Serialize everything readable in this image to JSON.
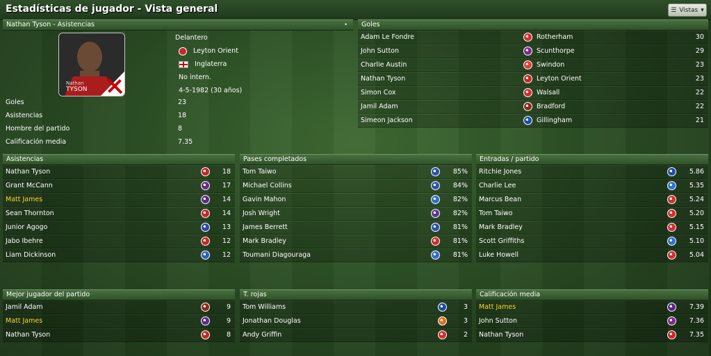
{
  "title": "Estadísticas de jugador - Vista general",
  "views_label": "Vistas",
  "player": {
    "panel_title": "Nathan Tyson - Asistencias",
    "photo_first": "Nathan",
    "photo_last": "TYSON",
    "position": "Delantero",
    "club": "Leyton Orient",
    "nation": "Inglaterra",
    "intl": "No intern.",
    "dob": "4-5-1982 (30 años)",
    "stats": [
      {
        "label": "Goles",
        "value": "23"
      },
      {
        "label": "Asistencias",
        "value": "18"
      },
      {
        "label": "Hombre del partido",
        "value": "8"
      },
      {
        "label": "Calificación media",
        "value": "7.35"
      }
    ]
  },
  "goals": {
    "title": "Goles",
    "rows": [
      {
        "name": "Adam Le Fondre",
        "team": "Rotherham",
        "value": "30",
        "color": "#d32f2f"
      },
      {
        "name": "John Sutton",
        "team": "Scunthorpe",
        "value": "29",
        "color": "#7a2a8a"
      },
      {
        "name": "Charlie Austin",
        "team": "Swindon",
        "value": "23",
        "color": "#e53935"
      },
      {
        "name": "Nathan Tyson",
        "team": "Leyton Orient",
        "value": "23",
        "color": "#c62828"
      },
      {
        "name": "Simon Cox",
        "team": "Walsall",
        "value": "22",
        "color": "#d32f2f"
      },
      {
        "name": "Jamil Adam",
        "team": "Bradford",
        "value": "22",
        "color": "#8d2b1b"
      },
      {
        "name": "Simeon Jackson",
        "team": "Gillingham",
        "value": "21",
        "color": "#1e4fa8"
      }
    ]
  },
  "assists": {
    "title": "Asistencias",
    "rows": [
      {
        "name": "Nathan Tyson",
        "value": "18",
        "color": "#c62828",
        "hl": false
      },
      {
        "name": "Grant McCann",
        "value": "17",
        "color": "#6b2a8a",
        "hl": false
      },
      {
        "name": "Matt James",
        "value": "14",
        "color": "#5b2a8a",
        "hl": true
      },
      {
        "name": "Sean Thornton",
        "value": "14",
        "color": "#c62828",
        "hl": false
      },
      {
        "name": "Junior Agogo",
        "value": "13",
        "color": "#2a4aa8",
        "hl": false
      },
      {
        "name": "Jabo Ibehre",
        "value": "12",
        "color": "#c62828",
        "hl": false
      },
      {
        "name": "Liam Dickinson",
        "value": "12",
        "color": "#2f5fc2",
        "hl": false
      }
    ]
  },
  "passes": {
    "title": "Pases completados",
    "rows": [
      {
        "name": "Tom Taiwo",
        "value": "85%",
        "color": "#2a55b0"
      },
      {
        "name": "Michael Collins",
        "value": "84%",
        "color": "#2a55b0"
      },
      {
        "name": "Gavin Mahon",
        "value": "82%",
        "color": "#2f6fd2"
      },
      {
        "name": "Josh Wright",
        "value": "82%",
        "color": "#5b3a9a"
      },
      {
        "name": "James Berrett",
        "value": "81%",
        "color": "#2a55b0"
      },
      {
        "name": "Mark Bradley",
        "value": "81%",
        "color": "#d32f2f"
      },
      {
        "name": "Toumani Diagouraga",
        "value": "81%",
        "color": "#2f6fd2"
      }
    ]
  },
  "tackles": {
    "title": "Entradas / partido",
    "rows": [
      {
        "name": "Ritchie Jones",
        "value": "5.86",
        "color": "#1e4fa8"
      },
      {
        "name": "Charlie Lee",
        "value": "5.35",
        "color": "#2f6fd2"
      },
      {
        "name": "Marcus Bean",
        "value": "5.24",
        "color": "#d32f2f"
      },
      {
        "name": "Tom Taiwo",
        "value": "5.20",
        "color": "#d32f2f"
      },
      {
        "name": "Mark Bradley",
        "value": "5.15",
        "color": "#d32f2f"
      },
      {
        "name": "Scott Griffiths",
        "value": "5.10",
        "color": "#2f6fd2"
      },
      {
        "name": "Luke Howell",
        "value": "5.04",
        "color": "#d32f2f"
      }
    ]
  },
  "motm": {
    "title": "Mejor jugador del partido",
    "rows": [
      {
        "name": "Jamil Adam",
        "value": "9",
        "color": "#8d2b1b",
        "hl": false
      },
      {
        "name": "Matt James",
        "value": "9",
        "color": "#5b2a8a",
        "hl": true
      },
      {
        "name": "Nathan Tyson",
        "value": "8",
        "color": "#c62828",
        "hl": false
      }
    ]
  },
  "reds": {
    "title": "T. rojas",
    "rows": [
      {
        "name": "Tom Williams",
        "value": "3",
        "color": "#1e4fa8"
      },
      {
        "name": "Jonathan Douglas",
        "value": "3",
        "color": "#e07020"
      },
      {
        "name": "Andy Griffin",
        "value": "2",
        "color": "#d32f2f"
      }
    ]
  },
  "rating": {
    "title": "Calificación media",
    "rows": [
      {
        "name": "Matt James",
        "value": "7.39",
        "color": "#5b2a8a",
        "hl": true
      },
      {
        "name": "John Sutton",
        "value": "7.36",
        "color": "#7a2a8a",
        "hl": false
      },
      {
        "name": "Nathan Tyson",
        "value": "7.35",
        "color": "#c62828",
        "hl": false
      }
    ]
  }
}
